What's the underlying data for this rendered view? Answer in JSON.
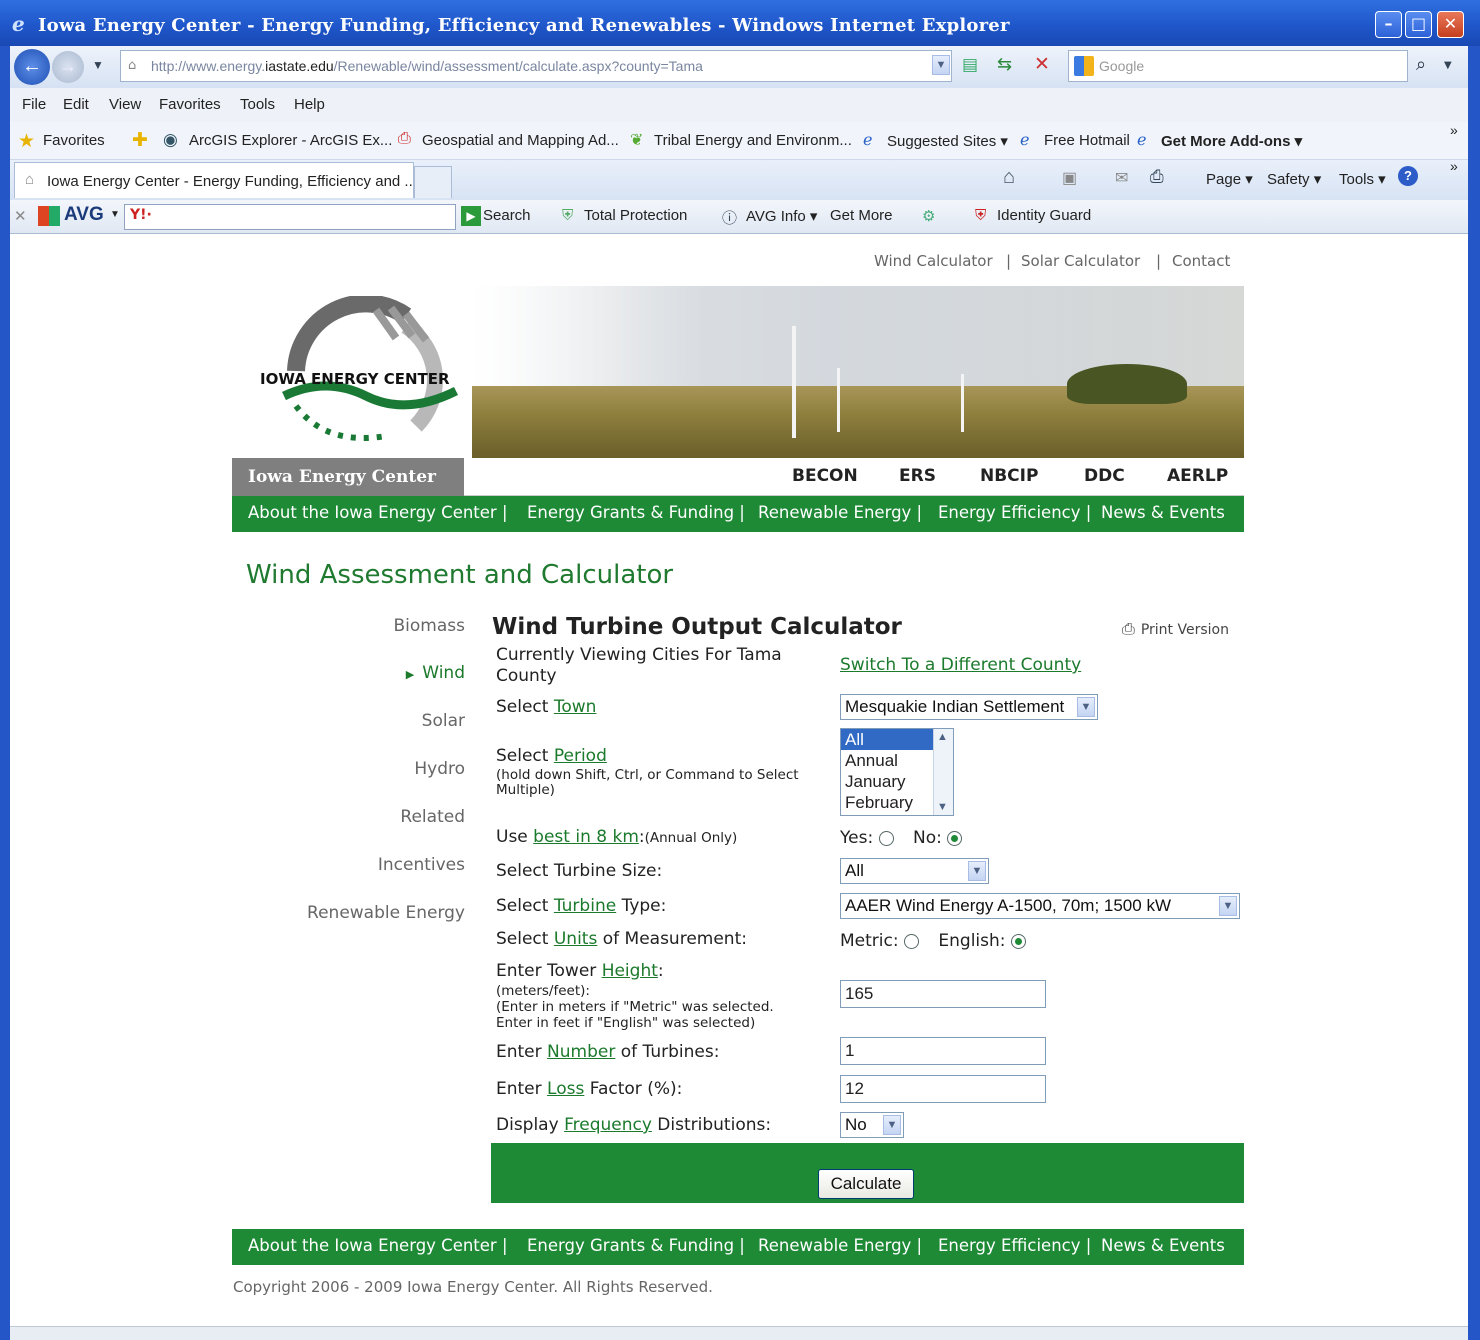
{
  "window": {
    "title": "Iowa Energy Center - Energy Funding, Efficiency and Renewables - Windows Internet Explorer"
  },
  "address": {
    "url_prefix": "http://www.energy.",
    "url_domain": "iastate.edu",
    "url_path": "/Renewable/wind/assessment/calculate.aspx?county=Tama",
    "search_placeholder": "Google"
  },
  "menu": [
    "File",
    "Edit",
    "View",
    "Favorites",
    "Tools",
    "Help"
  ],
  "favorites": {
    "label": "Favorites",
    "items": [
      "ArcGIS Explorer - ArcGIS Ex...",
      "Geospatial and Mapping Ad...",
      "Tribal Energy and Environm...",
      "Suggested Sites ▾",
      "Free Hotmail",
      "Get More Add-ons ▾"
    ]
  },
  "tab": {
    "label": "Iowa Energy Center - Energy Funding, Efficiency and ...",
    "commands": [
      "Page ▾",
      "Safety ▾",
      "Tools ▾"
    ]
  },
  "avg": {
    "brand": "AVG",
    "items": [
      "Search",
      "Total Protection",
      "AVG Info ▾",
      "Get More",
      "Identity Guard"
    ]
  },
  "toplinks": [
    "Wind Calculator",
    "|",
    "Solar Calculator",
    "|",
    "Contact"
  ],
  "logo_text": "IOWA ENERGY CENTER",
  "nav": {
    "tab": "Iowa Energy Center",
    "links": [
      "BECON",
      "ERS",
      "NBCIP",
      "DDC",
      "AERLP"
    ]
  },
  "greenlinks": [
    "About the Iowa Energy Center |",
    "Energy Grants & Funding |",
    "Renewable Energy |",
    "Energy Efficiency |",
    "News & Events"
  ],
  "page_title": "Wind Assessment and Calculator",
  "sidebar": [
    "Biomass",
    "Wind",
    "Solar",
    "Hydro",
    "Related",
    "Incentives",
    "Renewable Energy"
  ],
  "calc": {
    "title": "Wind Turbine Output Calculator",
    "print": "Print Version",
    "viewing": [
      "Currently Viewing Cities For Tama",
      "County"
    ],
    "switch_county": "Switch To a Different County",
    "town": {
      "pre": "Select ",
      "link": "Town",
      "value": "Mesquakie Indian Settlement"
    },
    "period": {
      "pre": "Select ",
      "link": "Period",
      "note1": "(hold down Shift, Ctrl, or Command to Select",
      "note2": "Multiple)",
      "options": [
        "All",
        "Annual",
        "January",
        "February"
      ],
      "selected": "All"
    },
    "best": {
      "pre": "Use ",
      "link": "best in 8 km",
      "post": ":",
      "note": "(Annual Only)",
      "yes": "Yes:",
      "no": "No:",
      "value": "No"
    },
    "size": {
      "label": "Select Turbine Size:",
      "value": "All"
    },
    "turbine": {
      "pre": "Select ",
      "link": "Turbine",
      "post": " Type:",
      "value": "AAER Wind Energy A-1500, 70m; 1500 kW"
    },
    "units": {
      "pre": "Select ",
      "link": "Units",
      "post": " of Measurement:",
      "metric": "Metric:",
      "english": "English:",
      "value": "English"
    },
    "height": {
      "pre": "Enter Tower ",
      "link": "Height",
      "post": ":",
      "n1": "(meters/feet):",
      "n2": "(Enter in meters if \"Metric\" was selected.",
      "n3": "Enter in feet if \"English\" was selected)",
      "value": "165"
    },
    "number": {
      "pre": "Enter ",
      "link": "Number",
      "post": " of Turbines:",
      "value": "1"
    },
    "loss": {
      "pre": "Enter ",
      "link": "Loss",
      "post": " Factor (%):",
      "value": "12"
    },
    "freq": {
      "pre": "Display ",
      "link": "Frequency",
      "post": " Distributions:",
      "value": "No"
    },
    "calculate": "Calculate"
  },
  "copyright": "Copyright 2006 - 2009 Iowa Energy Center. All Rights Reserved."
}
